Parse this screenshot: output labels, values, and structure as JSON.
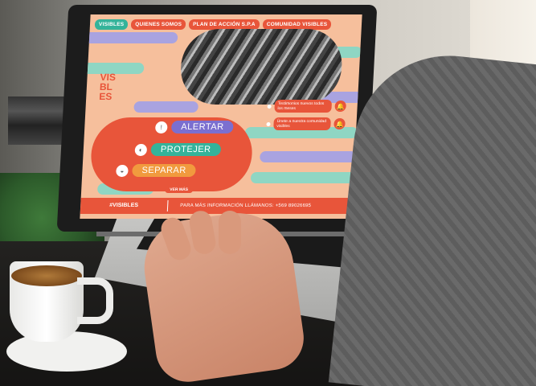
{
  "site": {
    "nav": [
      "VISIBLES",
      "QUIENES SOMOS",
      "PLAN DE ACCIÓN S.P.A",
      "COMUNIDAD VISIBLES"
    ],
    "logo": [
      "VIS",
      "BL",
      "ES"
    ],
    "notifications": [
      {
        "text": "Testimonios nuevos todos los meses",
        "icon": "bell-icon"
      },
      {
        "text": "Únete a nuestra comunidad visibles",
        "icon": "bell-icon"
      }
    ],
    "actions": [
      {
        "label": "ALERTAR",
        "color": "#7b6fd0",
        "icon": "alert-icon"
      },
      {
        "label": "PROTEJER",
        "color": "#34b39a",
        "icon": "shield-icon"
      },
      {
        "label": "SEPARAR",
        "color": "#f19a3e",
        "icon": "split-icon"
      }
    ],
    "ver_mas": "VER MÁS",
    "footer": {
      "hashtag": "#VISIBLES",
      "info": "PARA MÁS INFORMACIÓN LLÁMANOS: +569 89026695"
    }
  },
  "colors": {
    "accent": "#e8553a",
    "teal": "#34b39a",
    "lavender": "#a9a3e0",
    "mint": "#8fd6c3",
    "peach": "#f6bf9c"
  }
}
